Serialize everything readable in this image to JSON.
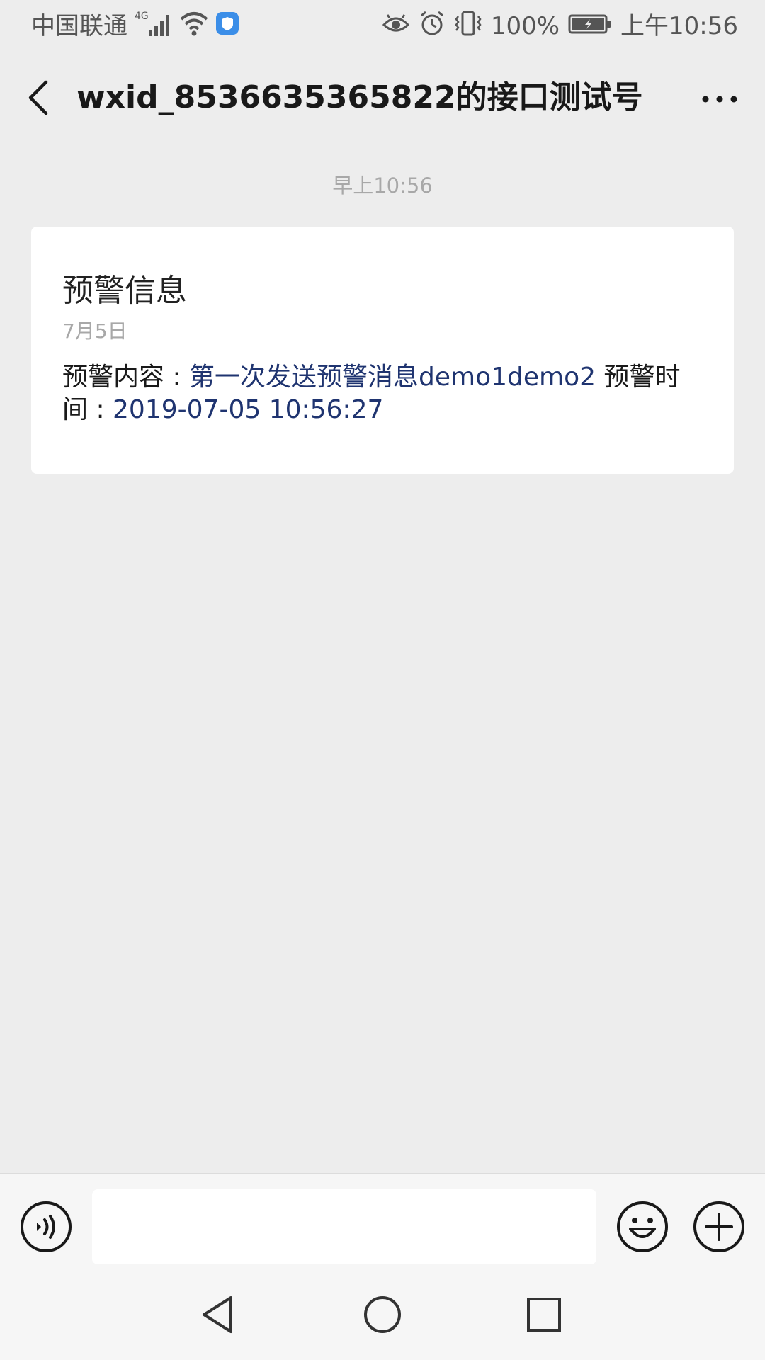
{
  "status_bar": {
    "carrier": "中国联通",
    "network": "4G",
    "battery_percent": "100%",
    "time": "上午10:56",
    "icons": [
      "signal-icon",
      "wifi-icon",
      "shield-icon",
      "eye-icon",
      "alarm-icon",
      "vibrate-icon",
      "battery-icon"
    ]
  },
  "title_bar": {
    "title": "wxid_8536635365822的接口测试号",
    "back_icon": "chevron-left-icon",
    "more_icon": "more-dots-icon"
  },
  "chat": {
    "timestamp": "早上10:56",
    "card": {
      "title": "预警信息",
      "date": "7月5日",
      "content_label": "预警内容 : ",
      "content_value": "第一次发送预警消息demo1demo2",
      "time_label": " 预警时间 : ",
      "time_value": "2019-07-05 10:56:27"
    }
  },
  "input_bar": {
    "placeholder": "",
    "voice_icon": "voice-icon",
    "emoji_icon": "emoji-icon",
    "plus_icon": "plus-icon"
  },
  "nav_bar": {
    "icons": [
      "nav-back-icon",
      "nav-home-icon",
      "nav-recent-icon"
    ]
  },
  "colors": {
    "background": "#ededed",
    "card": "#ffffff",
    "link_value": "#1f3470",
    "muted": "#a8a8a8"
  }
}
